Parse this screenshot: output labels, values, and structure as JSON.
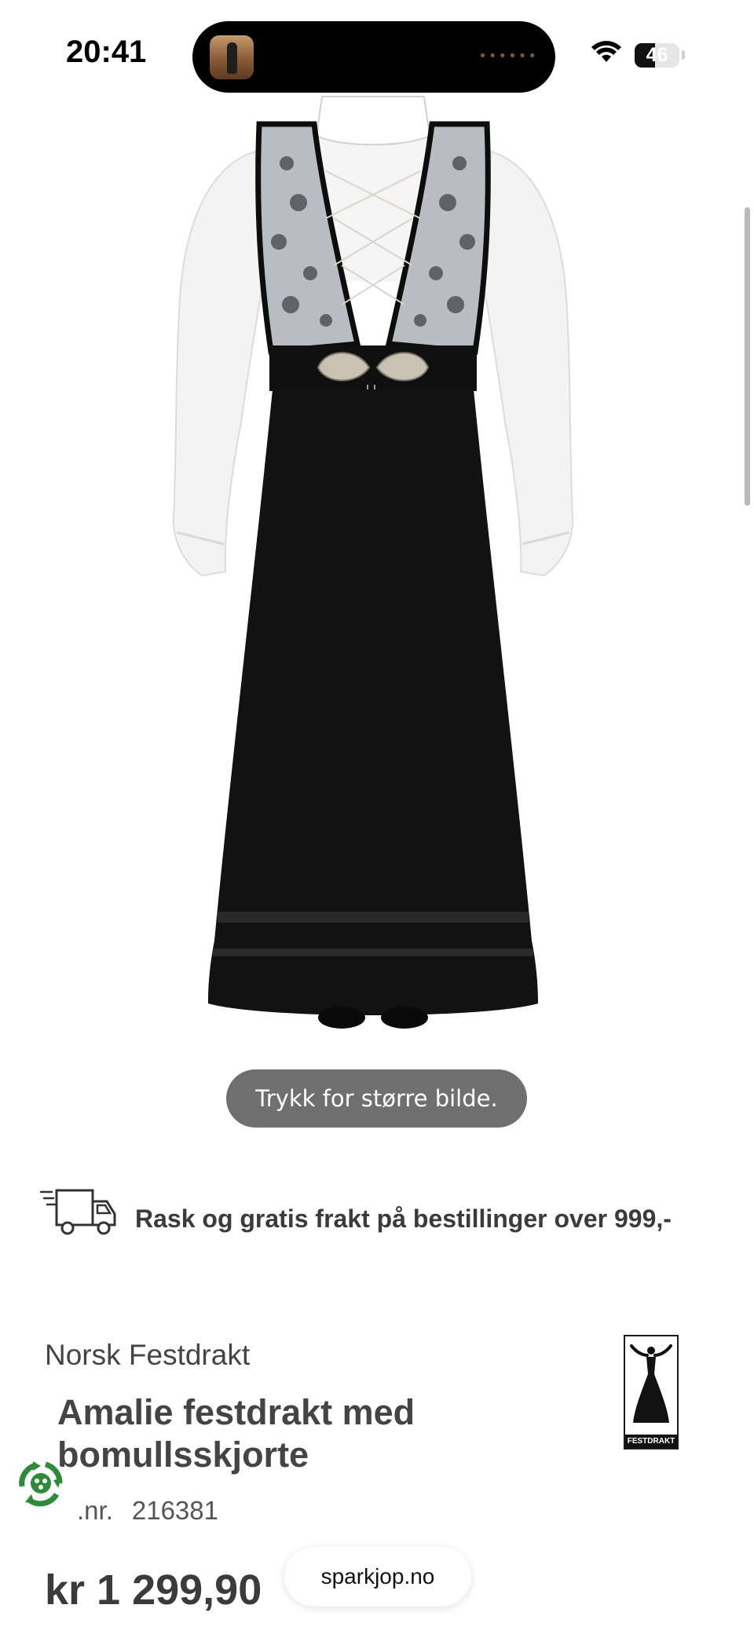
{
  "status_bar": {
    "time": "20:41",
    "battery_level": "46",
    "signal_icon": "wifi-icon"
  },
  "product_image": {
    "hint": "Trykk for større bilde.",
    "colors": {
      "skirt": "#121212",
      "shirt": "#f2f2f2",
      "bodice": "#b9bcc2",
      "trim": "#0d0d0d",
      "clasp": "#c9c2b4"
    }
  },
  "shipping": {
    "icon": "delivery-truck-icon",
    "text": "Rask og gratis frakt på bestillinger over 999,-"
  },
  "product": {
    "brand": "Norsk Festdrakt",
    "brand_logo_text": "FESTDRAKT",
    "title": "Amalie festdrakt med bomullsskjorte",
    "artnr_label": ".nr.",
    "artnr_value": "216381",
    "price": "kr 1 299,90"
  },
  "browser": {
    "url": "sparkjop.no"
  }
}
